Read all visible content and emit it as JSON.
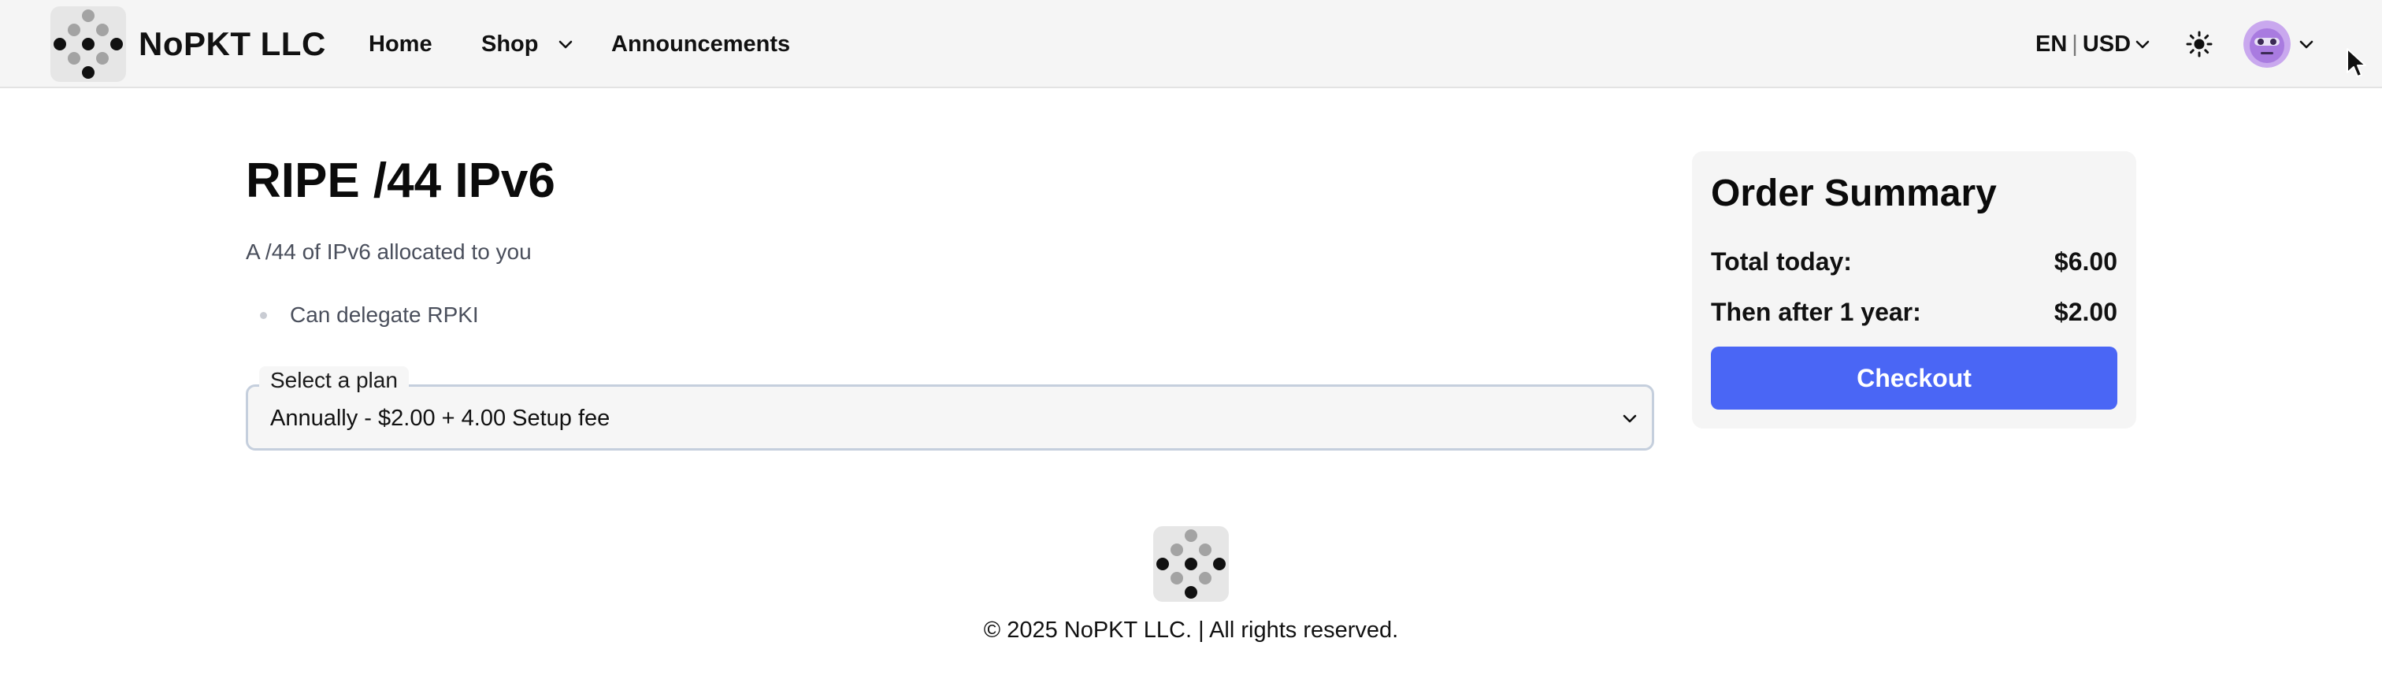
{
  "header": {
    "brand": "NoPKT LLC",
    "nav": {
      "home": "Home",
      "shop": "Shop",
      "announcements": "Announcements"
    },
    "locale": {
      "language": "EN",
      "separator": "|",
      "currency": "USD"
    },
    "icons": {
      "logo": "dots-logo-icon",
      "shop_dropdown": "chevron-down-icon",
      "theme": "sun-icon",
      "avatar": "avatar",
      "user_dropdown": "chevron-down-icon"
    }
  },
  "product": {
    "title": "RIPE /44 IPv6",
    "description": "A /44 of IPv6 allocated to you",
    "features": [
      "Can delegate RPKI"
    ]
  },
  "plan_select": {
    "label": "Select a plan",
    "selected": "Annually - $2.00 + 4.00 Setup fee"
  },
  "order_summary": {
    "title": "Order Summary",
    "total_today_label": "Total today:",
    "total_today_value": "$6.00",
    "then_after_label": "Then after 1 year:",
    "then_after_value": "$2.00",
    "checkout_label": "Checkout"
  },
  "footer": {
    "copyright": "© 2025 NoPKT LLC. | All rights reserved."
  },
  "colors": {
    "accent": "#4a66f5",
    "header_bg": "#f5f5f5",
    "summary_bg": "#f5f5f5",
    "muted_text": "#4a4f5c",
    "avatar_bg": "#b88ae8"
  }
}
